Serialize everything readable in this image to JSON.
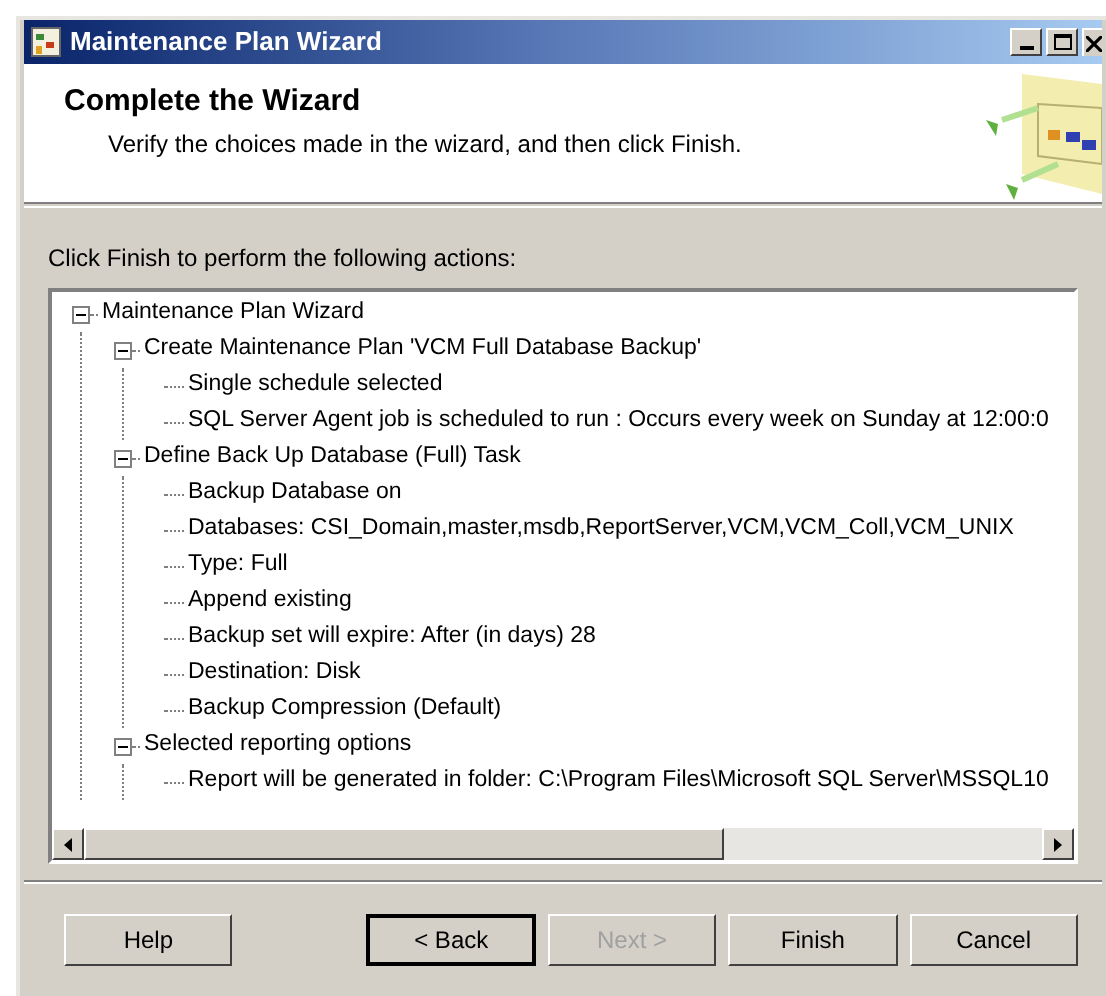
{
  "window": {
    "title": "Maintenance Plan Wizard"
  },
  "header": {
    "title": "Complete the Wizard",
    "subtitle": "Verify the choices made in the wizard, and then click Finish."
  },
  "instructions": "Click Finish to perform the following actions:",
  "tree": [
    {
      "label": "Maintenance Plan Wizard",
      "expanded": true,
      "children": [
        {
          "label": "Create Maintenance Plan 'VCM Full Database Backup'",
          "expanded": true,
          "children": [
            {
              "label": "Single schedule selected"
            },
            {
              "label": "SQL Server Agent job is scheduled to run : Occurs every week on Sunday at 12:00:0"
            }
          ]
        },
        {
          "label": "Define Back Up Database (Full) Task",
          "expanded": true,
          "children": [
            {
              "label": "Backup Database on"
            },
            {
              "label": "Databases: CSI_Domain,master,msdb,ReportServer,VCM,VCM_Coll,VCM_UNIX"
            },
            {
              "label": "Type: Full"
            },
            {
              "label": "Append existing"
            },
            {
              "label": "Backup set will expire: After (in days) 28"
            },
            {
              "label": "Destination: Disk"
            },
            {
              "label": "Backup Compression (Default)"
            }
          ]
        },
        {
          "label": "Selected reporting options",
          "expanded": true,
          "children": [
            {
              "label": "Report will be generated in folder: C:\\Program Files\\Microsoft SQL Server\\MSSQL10"
            }
          ]
        }
      ]
    }
  ],
  "buttons": [
    {
      "label": "Help",
      "disabled": false,
      "default": false
    },
    {
      "label": "< Back",
      "disabled": false,
      "default": true
    },
    {
      "label": "Next >",
      "disabled": true,
      "default": false
    },
    {
      "label": "Finish",
      "disabled": false,
      "default": false
    },
    {
      "label": "Cancel",
      "disabled": false,
      "default": false
    }
  ]
}
